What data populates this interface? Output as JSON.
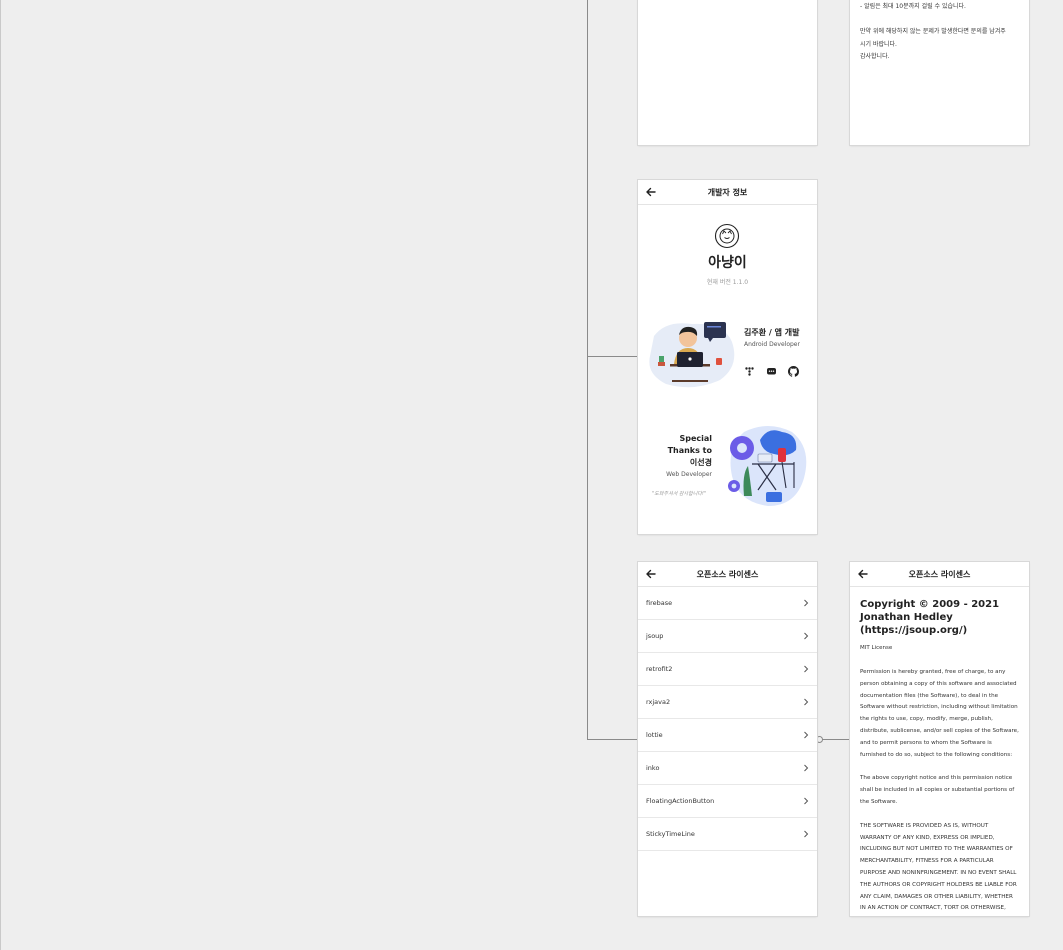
{
  "notice": {
    "lines": [
      "- 알림은 최대 10분까지 걸릴 수 있습니다.",
      "",
      "만약 위에 해당하지 않는 문제가 발생한다면 문의를 남겨주",
      "시기 바랍니다.",
      "감사합니다."
    ]
  },
  "developer": {
    "header_title": "개발자 정보",
    "app_name": "아냥이",
    "version_text": "현재 버전 1.1.0",
    "dev_name": "김주환 / 앱 개발",
    "dev_role": "Android Developer",
    "thanks_line1": "Special",
    "thanks_line2": "Thanks to",
    "thanks_line3": "이선경",
    "web_role": "Web Developer",
    "quote": "\"도와주셔서 감사합니다!\""
  },
  "oss_list": {
    "header_title": "오픈소스 라이센스",
    "items": [
      "firebase",
      "jsoup",
      "retrofit2",
      "rxjava2",
      "lottie",
      "inko",
      "FloatingActionButton",
      "StickyTimeLine"
    ]
  },
  "license": {
    "header_title": "오픈소스 라이센스",
    "title": "Copyright © 2009 - 2021 Jonathan Hedley (https://jsoup.org/)",
    "license_name": "MIT License",
    "para1": "Permission is hereby granted, free of charge, to any person obtaining a copy of this software and associated documentation files (the Software), to deal in the Software without restriction, including without limitation the rights to use, copy, modify, merge, publish, distribute, sublicense, and/or sell copies of the Software, and to permit persons to whom the Software is furnished to do so, subject to the following conditions:",
    "para2": "The above copyright notice and this permission notice shall be included in all copies or substantial portions of the Software.",
    "para3": "THE SOFTWARE IS PROVIDED AS IS, WITHOUT WARRANTY OF ANY KIND, EXPRESS OR IMPLIED, INCLUDING BUT NOT LIMITED TO THE WARRANTIES OF MERCHANTABILITY, FITNESS FOR A PARTICULAR PURPOSE AND NONINFRINGEMENT. IN NO EVENT SHALL THE AUTHORS OR COPYRIGHT HOLDERS BE LIABLE FOR ANY CLAIM, DAMAGES OR OTHER LIABILITY, WHETHER IN AN ACTION OF CONTRACT, TORT OR OTHERWISE, ARISING FROM, OUT OF OR IN CONNECTION WITH THE"
  },
  "icons": {
    "back": "arrow-left-icon",
    "chevron": "chevron-right-icon",
    "logo": "cat-logo-icon",
    "social": [
      "tistory-icon",
      "message-icon",
      "github-icon"
    ]
  },
  "colors": {
    "canvas": "#eeeeee",
    "frame": "#ffffff",
    "accent_blue": "#3b6fe0",
    "accent_purple": "#6b5ce7"
  }
}
